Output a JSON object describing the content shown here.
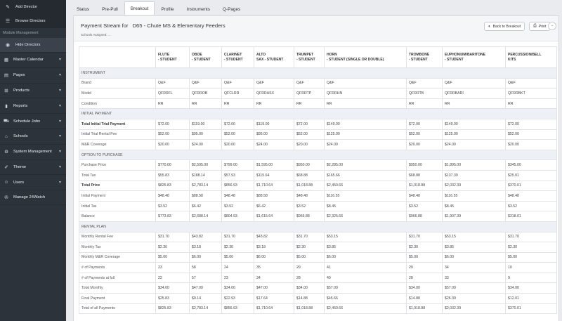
{
  "sidebar": {
    "top_items": [
      {
        "label": "Add Director",
        "icon": "edit-icon"
      },
      {
        "label": "Browse Directors",
        "icon": "list-icon"
      }
    ],
    "section_label": "Module Management",
    "active_item": {
      "label": "Hide Directors",
      "icon": "eye-icon"
    },
    "main_items": [
      {
        "label": "Master Calendar",
        "icon": "calendar-icon"
      },
      {
        "label": "Pages",
        "icon": "page-icon"
      },
      {
        "label": "Products",
        "icon": "cart-icon"
      },
      {
        "label": "Reports",
        "icon": "bar-chart-icon"
      },
      {
        "label": "Schedule Jobs",
        "icon": "truck-icon"
      },
      {
        "label": "Schools",
        "icon": "school-icon"
      },
      {
        "label": "System Management",
        "icon": "cogs-icon"
      },
      {
        "label": "Theme",
        "icon": "brush-icon"
      },
      {
        "label": "Users",
        "icon": "users-icon"
      },
      {
        "label": "Manage 24Watch",
        "icon": "wrench-icon"
      }
    ]
  },
  "tabs": [
    "Status",
    "Pre-Pull",
    "Breakout",
    "Profile",
    "Instruments",
    "Q-Pages"
  ],
  "active_tab": "Breakout",
  "panel": {
    "title": "Payment Stream for",
    "title_school": "D65 - Chute MS & Elementary Feeders",
    "subtitle": "Schools Assigned: ...",
    "back_button": "Back to Breakout",
    "print_button": "Print",
    "collapse_button": "–"
  },
  "table": {
    "columns": [
      {
        "name": "FLUTE",
        "sub": "- STUDENT"
      },
      {
        "name": "OBOE",
        "sub": "- STUDENT"
      },
      {
        "name": "CLARINET",
        "sub": "- STUDENT"
      },
      {
        "name": "ALTO",
        "sub": "SAX - STUDENT"
      },
      {
        "name": "TRUMPET",
        "sub": "- STUDENT"
      },
      {
        "name": "HORN",
        "sub": "- STUDENT (SINGLE OR DOUBLE)"
      },
      {
        "name": "TROMBONE",
        "sub": "- STUDENT"
      },
      {
        "name": "EUPHONIUM/BARITONE",
        "sub": "- STUDENT"
      },
      {
        "name": "PERCUSSION/BELL",
        "sub": "KITS"
      }
    ],
    "rows": [
      {
        "type": "section",
        "label": "INSTRUMENT"
      },
      {
        "label": "Brand",
        "values": [
          "Q&F",
          "Q&F",
          "Q&F",
          "Q&F",
          "Q&F",
          "Q&F",
          "Q&F",
          "Q&F",
          "Q&F"
        ]
      },
      {
        "label": "Model",
        "values": [
          "QFRRFL",
          "QFRROB",
          "QFCLRR",
          "QFRRASX",
          "QFRRTP",
          "QFRRHN",
          "QFRRTB",
          "QFRRBARI",
          "QFRRBKT"
        ]
      },
      {
        "label": "Condition",
        "values": [
          "RR",
          "RR",
          "RR",
          "RR",
          "RR",
          "RR",
          "RR",
          "RR",
          "RR"
        ]
      },
      {
        "type": "section",
        "label": "INITIAL PAYMENT"
      },
      {
        "label": "Total Initial Trial Payment",
        "bold": true,
        "values": [
          "$72.00",
          "$119.00",
          "$72.00",
          "$119.00",
          "$72.00",
          "$149.00",
          "$72.00",
          "$149.00",
          "$72.00"
        ]
      },
      {
        "label": "Initial Trial Rental Fee",
        "values": [
          "$52.00",
          "$95.00",
          "$52.00",
          "$95.00",
          "$52.00",
          "$125.00",
          "$52.00",
          "$125.00",
          "$52.00"
        ]
      },
      {
        "label": "M&R Coverage",
        "values": [
          "$20.00",
          "$24.00",
          "$20.00",
          "$24.00",
          "$20.00",
          "$24.00",
          "$20.00",
          "$24.00",
          "$20.00"
        ]
      },
      {
        "type": "section",
        "label": "OPTION TO PURCHASE"
      },
      {
        "label": "Purchase Price",
        "values": [
          "$770.00",
          "$2,595.00",
          "$799.00",
          "$1,595.00",
          "$950.00",
          "$2,285.00",
          "$950.00",
          "$1,895.00",
          "$345.00"
        ]
      },
      {
        "label": "Total Tax",
        "values": [
          "$55.83",
          "$188.14",
          "$57.93",
          "$115.64",
          "$68.88",
          "$165.66",
          "$68.88",
          "$137.39",
          "$25.01"
        ]
      },
      {
        "label": "Total Price",
        "bold": true,
        "values": [
          "$825.83",
          "$2,783.14",
          "$856.93",
          "$1,710.64",
          "$1,018.88",
          "$2,450.66",
          "$1,018.88",
          "$2,032.39",
          "$370.01"
        ]
      },
      {
        "label": "Initial Payment",
        "values": [
          "$48.48",
          "$88.58",
          "$48.48",
          "$88.58",
          "$48.48",
          "$116.55",
          "$48.48",
          "$116.55",
          "$48.48"
        ]
      },
      {
        "label": "Initial Tax",
        "values": [
          "$3.52",
          "$6.42",
          "$3.52",
          "$6.42",
          "$3.52",
          "$8.45",
          "$3.52",
          "$8.45",
          "$3.52"
        ]
      },
      {
        "label": "Balance",
        "values": [
          "$773.83",
          "$2,688.14",
          "$804.93",
          "$1,615.64",
          "$966.88",
          "$2,325.66",
          "$966.88",
          "$1,907.39",
          "$318.01"
        ]
      },
      {
        "type": "section",
        "label": "RENTAL PLAN"
      },
      {
        "label": "Monthly Rental Fee",
        "values": [
          "$31.70",
          "$43.82",
          "$31.70",
          "$43.82",
          "$31.70",
          "$53.15",
          "$31.70",
          "$53.15",
          "$31.70"
        ]
      },
      {
        "label": "Monthly Tax",
        "values": [
          "$2.30",
          "$3.18",
          "$2.30",
          "$3.18",
          "$2.30",
          "$3.85",
          "$2.30",
          "$3.85",
          "$2.30"
        ]
      },
      {
        "label": "Monthly M&R Coverage",
        "values": [
          "$5.00",
          "$6.00",
          "$5.00",
          "$6.00",
          "$5.00",
          "$6.00",
          "$5.00",
          "$6.00",
          "$5.00"
        ]
      },
      {
        "label": "# of Payments",
        "values": [
          "23",
          "58",
          "24",
          "35",
          "29",
          "41",
          "29",
          "34",
          "10"
        ]
      },
      {
        "label": "# of Payments at full",
        "values": [
          "22",
          "57",
          "23",
          "34",
          "28",
          "40",
          "28",
          "33",
          "9"
        ]
      },
      {
        "label": "Total Monthly",
        "values": [
          "$34.00",
          "$47.00",
          "$34.00",
          "$47.00",
          "$34.00",
          "$57.00",
          "$34.00",
          "$57.00",
          "$34.00"
        ]
      },
      {
        "label": "Final Payment",
        "values": [
          "$25.83",
          "$9.14",
          "$22.93",
          "$17.64",
          "$14.88",
          "$45.66",
          "$14.88",
          "$26.39",
          "$12.01"
        ]
      },
      {
        "label": "Total of all Payments",
        "values": [
          "$825.83",
          "$2,783.14",
          "$856.93",
          "$1,710.64",
          "$1,018.88",
          "$2,450.66",
          "$1,018.88",
          "$2,032.39",
          "$370.01"
        ]
      }
    ]
  },
  "colors": {
    "sidebar_bg": "#2d333b",
    "section_row_bg": "#edf1f5",
    "page_bg": "#e9ebee"
  }
}
